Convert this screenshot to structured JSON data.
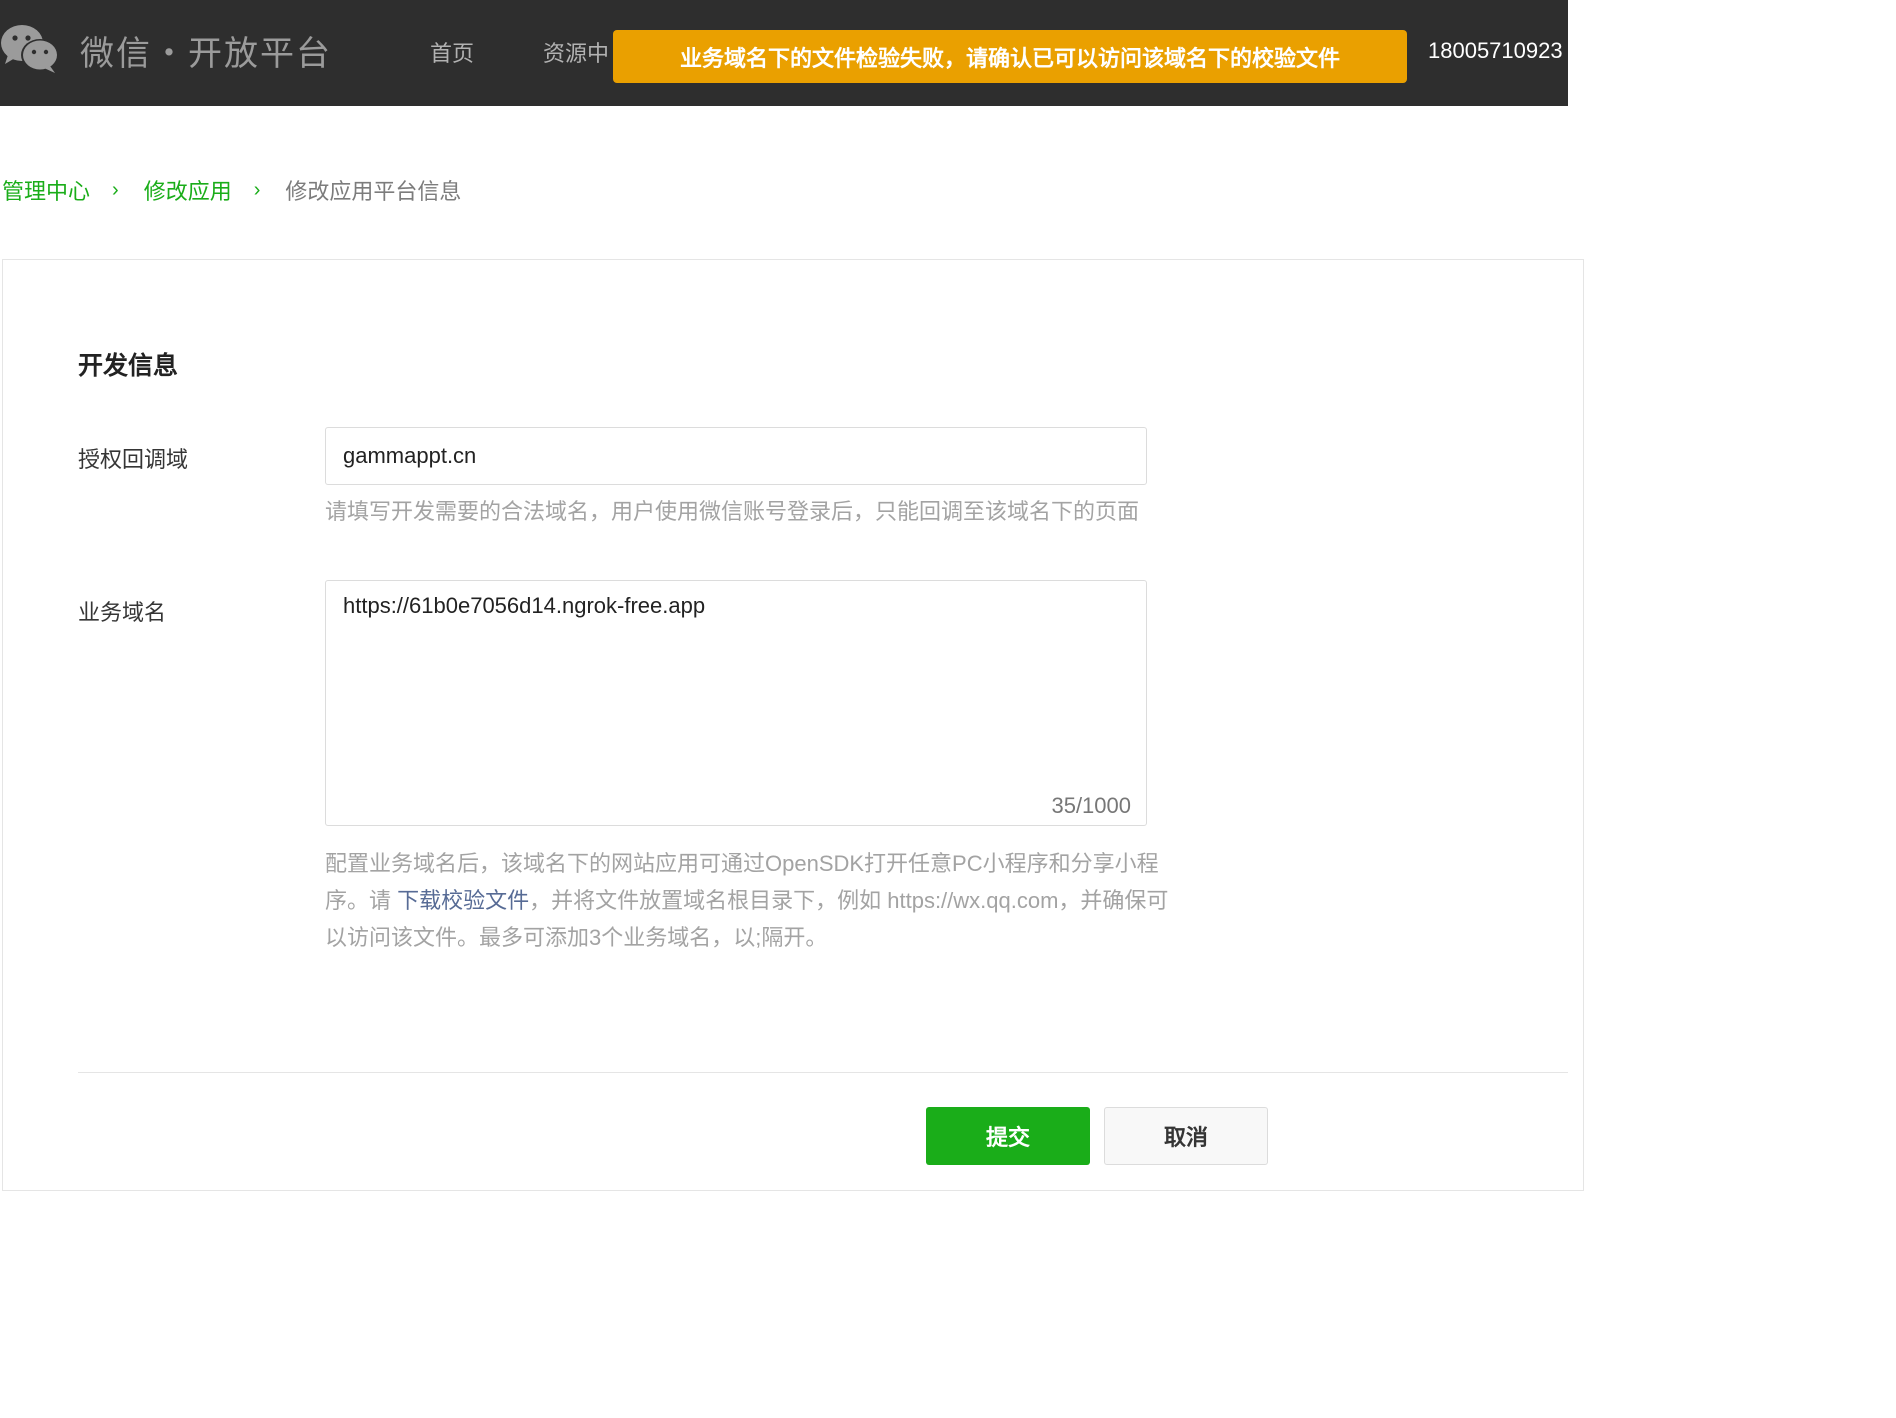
{
  "header": {
    "logo_icon": "wechat-icon",
    "logo_text": "微信・开放平台",
    "nav": {
      "home": "首页",
      "resources": "资源中"
    },
    "account": "18005710923"
  },
  "toast": {
    "message": "业务域名下的文件检验失败，请确认已可以访问该域名下的校验文件",
    "color": "#eaa000"
  },
  "breadcrumb": {
    "items": [
      "管理中心",
      "修改应用",
      "修改应用平台信息"
    ],
    "separator": "›"
  },
  "form": {
    "section_title": "开发信息",
    "auth_domain": {
      "label": "授权回调域",
      "value": "gammappt.cn",
      "hint": "请填写开发需要的合法域名，用户使用微信账号登录后，只能回调至该域名下的页面"
    },
    "business_domain": {
      "label": "业务域名",
      "value": "https://61b0e7056d14.ngrok-free.app",
      "counter": "35/1000",
      "hint_before": "配置业务域名后，该域名下的网站应用可通过OpenSDK打开任意PC小程序和分享小程序。请 ",
      "hint_link": "下载校验文件",
      "hint_after": "，并将文件放置域名根目录下，例如 https://wx.qq.com，并确保可以访问该文件。最多可添加3个业务域名，以;隔开。"
    }
  },
  "actions": {
    "submit": "提交",
    "cancel": "取消"
  },
  "colors": {
    "brand_green": "#1aad19",
    "link_blue": "#576b95",
    "topbar": "#2e2e2e"
  }
}
